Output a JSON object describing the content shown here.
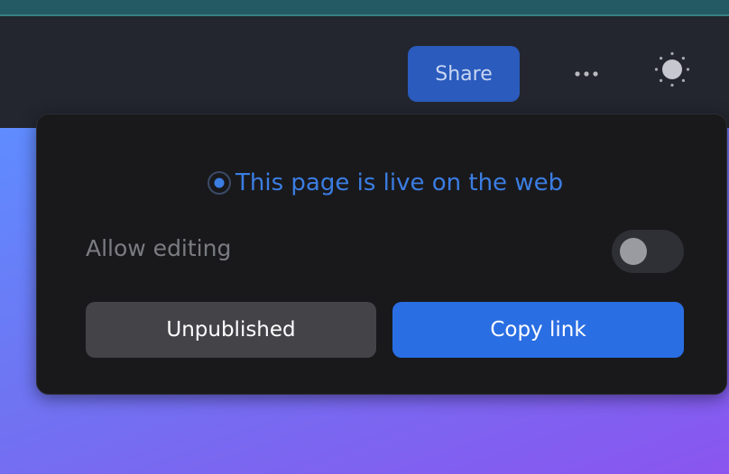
{
  "header": {
    "share_label": "Share",
    "more_icon": "ellipsis-icon",
    "theme_icon": "sun-icon"
  },
  "publish_popover": {
    "status_text": "This page is live on the web",
    "status_icon": "radio-selected-icon",
    "allow_editing_label": "Allow editing",
    "allow_editing_enabled": false,
    "unpublish_label": "Unpublished",
    "copy_link_label": "Copy link"
  },
  "colors": {
    "accent": "#2a6ee3",
    "share_button": "#2a5bbd",
    "status_text": "#3b7de2",
    "popover_bg": "#19191c"
  }
}
